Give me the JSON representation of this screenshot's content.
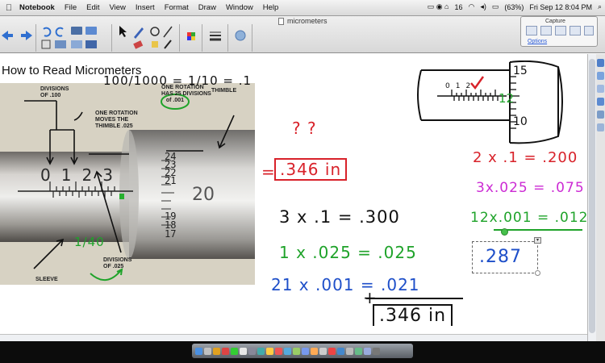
{
  "menubar": {
    "app_name": "Notebook",
    "menus": [
      "File",
      "Edit",
      "View",
      "Insert",
      "Format",
      "Draw",
      "Window",
      "Help"
    ],
    "status": {
      "number": "16",
      "battery": "(63%)",
      "clock": "Fri Sep 12  8:04 PM"
    }
  },
  "toolbar": {
    "document_title": "micrometers"
  },
  "capture_panel": {
    "title": "Capture",
    "options_label": "Options"
  },
  "lesson": {
    "heading": "How to Read Micrometers",
    "photo_labels": {
      "divisions_100": "DIVISIONS\nOF .100",
      "thimble": "THIMBLE",
      "one_rotation_25": "ONE ROTATION\nHAS 25 DIVISIONS\nof .001",
      "rotation_moves": "ONE ROTATION\nMOVES THE\nTHIMBLE .025",
      "sleeve": "SLEEVE",
      "divisions_025": "DIVISIONS\nOF .025"
    },
    "photo_sleeve_numbers": [
      "0",
      "1",
      "2",
      "3"
    ],
    "photo_thimble_numbers": [
      "24",
      "23",
      "22",
      "21",
      "20",
      "19",
      "18",
      "17"
    ],
    "annotations": {
      "fraction": "100/1000 = 1/10 = .1",
      "quarter": "1/40",
      "question_marks": "? ?",
      "result_top": ".346 in",
      "line1": "3 x .1 = .300",
      "line2": "1 x .025 = .025",
      "line3": "21 x .001 = .021",
      "result_bottom": ".346 in",
      "plus": "+",
      "r1": "2 x .1 = .200",
      "r2": "3x.025 = .075",
      "r3": "12x.001 = .012",
      "answer": ".287"
    },
    "diagram": {
      "sleeve_numbers": [
        "0",
        "1",
        "2"
      ],
      "thimble_numbers": [
        "15",
        "12",
        "10"
      ]
    }
  },
  "colors": {
    "red": "#d8222a",
    "green": "#1fa32a",
    "magenta": "#cc2bd4",
    "blue": "#1e4fc9",
    "black": "#111111"
  }
}
